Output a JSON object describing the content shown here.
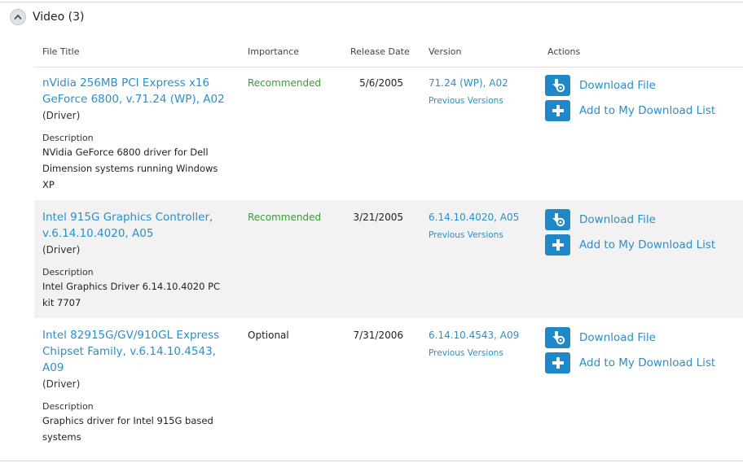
{
  "section": {
    "title": "Video (3)"
  },
  "columns": {
    "file_title": "File Title",
    "importance": "Importance",
    "release_date": "Release Date",
    "version": "Version",
    "actions": "Actions"
  },
  "rows": [
    {
      "title": "nVidia 256MB PCI Express x16 GeForce 6800, v.71.24 (WP), A02",
      "type": "(Driver)",
      "description_label": "Description",
      "description": "NVidia GeForce 6800 driver for Dell Dimension systems running Windows XP",
      "importance": "Recommended",
      "release_date": "5/6/2005",
      "version": "71.24 (WP), A02",
      "previous_versions": "Previous Versions",
      "download_label": "Download File",
      "add_label": "Add to My Download List"
    },
    {
      "title": "Intel 915G Graphics Controller, v.6.14.10.4020, A05",
      "type": "(Driver)",
      "description_label": "Description",
      "description": "Intel Graphics Driver 6.14.10.4020 PC kit 7707",
      "importance": "Recommended",
      "release_date": "3/21/2005",
      "version": "6.14.10.4020, A05",
      "previous_versions": "Previous Versions",
      "download_label": "Download File",
      "add_label": "Add to My Download List"
    },
    {
      "title": "Intel 82915G/GV/910GL Express Chipset Family, v.6.14.10.4543, A09",
      "type": "(Driver)",
      "description_label": "Description",
      "description": "Graphics driver for Intel 915G based systems",
      "importance": "Optional",
      "release_date": "7/31/2006",
      "version": "6.14.10.4543, A09",
      "previous_versions": "Previous Versions",
      "download_label": "Download File",
      "add_label": "Add to My Download List"
    }
  ],
  "icons": {
    "collapse": "chevron-up-icon",
    "download": "download-file-icon",
    "add": "plus-icon"
  },
  "colors": {
    "link": "#2b8fc7",
    "recommended": "#3a9a3a",
    "button": "#1e88c9",
    "row_shade": "#f2f2f2"
  }
}
